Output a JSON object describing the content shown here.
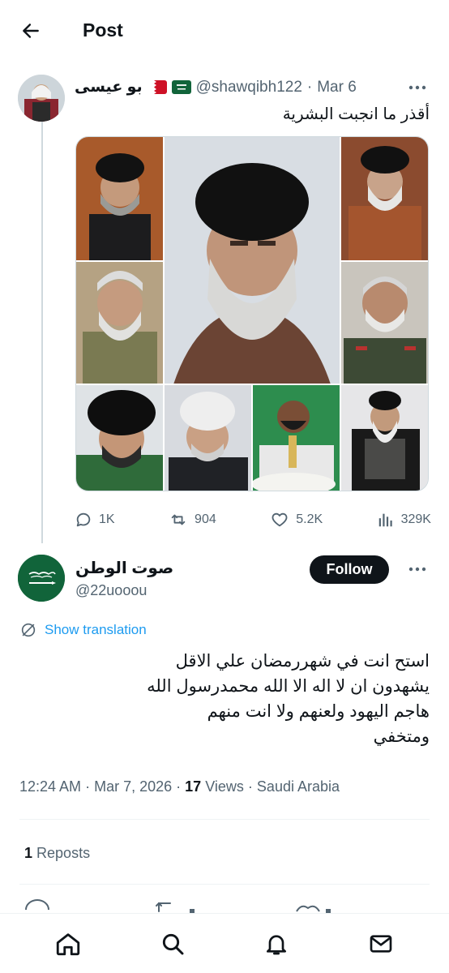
{
  "header": {
    "title": "Post"
  },
  "quoted_post": {
    "author_name": "بو عيسى",
    "handle": "@shawqibh122",
    "date": "Mar 6",
    "text": "أقذر ما انجبت البشرية",
    "flags": [
      "bahrain-flag",
      "saudi-flag"
    ]
  },
  "quoted_actions": {
    "replies": "1K",
    "reposts": "904",
    "likes": "5.2K",
    "views": "329K"
  },
  "reply_post": {
    "author_name": "صوت الوطن",
    "handle": "@22uooou",
    "follow_label": "Follow",
    "show_translation": "Show translation",
    "text_lines": [
      "استح انت في شهررمضان علي الاقل",
      "يشهدون ان لا اله الا الله محمدرسول الله",
      "هاجم اليهود ولعنهم ولا انت منهم",
      "ومتخفي"
    ],
    "time": "12:24 AM",
    "date": "Mar 7, 2026",
    "views_count": "17",
    "views_label": "Views",
    "location": "Saudi Arabia",
    "reposts_count": "1",
    "reposts_label": "Reposts"
  },
  "colors": {
    "accent": "#1d9bf0",
    "text": "#0f1419",
    "muted": "#536471",
    "divider": "#eff3f4",
    "saudi_green": "#11643a"
  },
  "bottom_nav": [
    "home-icon",
    "search-icon",
    "notifications-icon",
    "messages-icon"
  ]
}
